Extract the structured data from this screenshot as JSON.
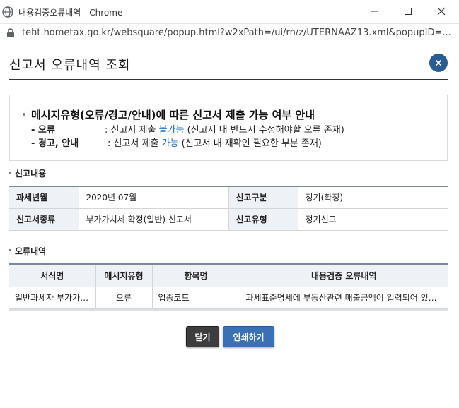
{
  "window": {
    "title": "내용검증오류내역 - Chrome",
    "url": "teht.hometax.go.kr/websquare/popup.html?w2xPath=/ui/rn/z/UTERNAAZ13.xml&popupID=..."
  },
  "popup": {
    "title": "신고서 오류내역 조회"
  },
  "notice": {
    "heading": "메시지유형(오류/경고/안내)에 따른 신고서 제출 가능 여부 안내",
    "error_label": "- 오류",
    "error_prefix": ": 신고서 제출 ",
    "error_status": "불가능",
    "error_suffix": " (신고서 내 반드시 수정해야할 오류 존재)",
    "warn_label": "- 경고, 안내",
    "warn_prefix": ": 신고서 제출 ",
    "warn_status": "가능",
    "warn_suffix": " (신고서 내 재확인 필요한 부분 존재)"
  },
  "report_section": {
    "title": "신고내용",
    "rows": [
      {
        "label1": "과세년월",
        "value1": "2020년 07월",
        "label2": "신고구분",
        "value2": "정기(확정)"
      },
      {
        "label1": "신고서종류",
        "value1": "부가가치세 확정(일반) 신고서",
        "label2": "신고유형",
        "value2": "정기신고"
      }
    ]
  },
  "error_section": {
    "title": "오류내역",
    "columns": [
      "서식명",
      "메시지유형",
      "항목명",
      "내용검증 오류내역"
    ],
    "rows": [
      [
        "일반과세자 부가가치세 신고서",
        "오류",
        "업종코드",
        "과세표준명세에 부동산관련 매출금액이 입력되어 있습니다."
      ]
    ]
  },
  "buttons": {
    "close": "닫기",
    "print": "인쇄하기"
  },
  "colors": {
    "accent_blue": "#1f6fc1",
    "close_circle": "#2a5c92",
    "print_button": "#3a71b5",
    "close_button": "#3d3d3d"
  }
}
